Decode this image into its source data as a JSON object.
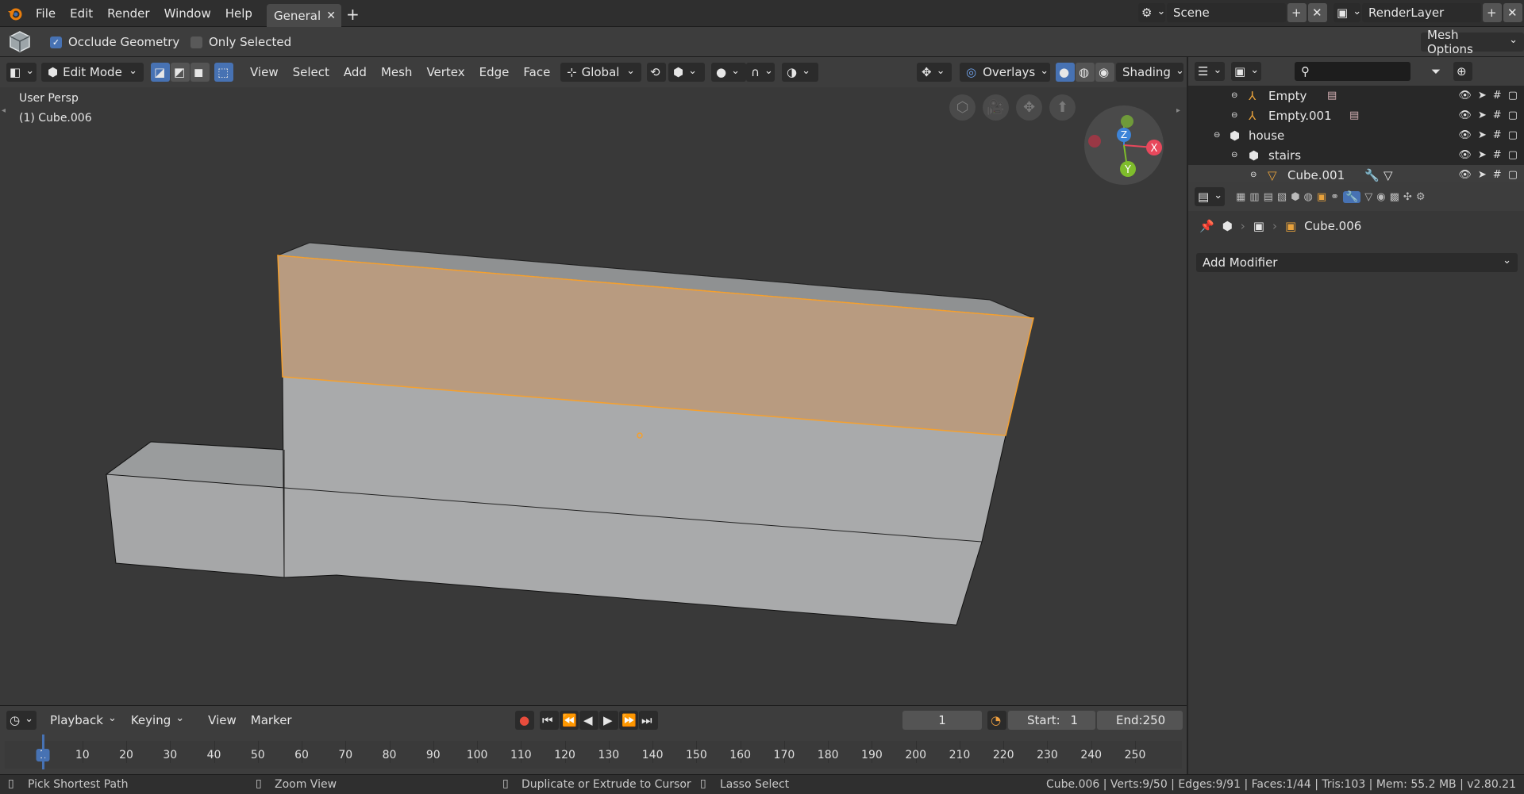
{
  "topbar": {
    "menus": [
      "File",
      "Edit",
      "Render",
      "Window",
      "Help"
    ],
    "workspace_tab": "General",
    "scene": "Scene",
    "render_layer": "RenderLayer"
  },
  "tool_header": {
    "occlude_geometry": "Occlude Geometry",
    "occlude_checked": true,
    "only_selected": "Only Selected",
    "only_selected_checked": false,
    "mesh_options": "Mesh Options"
  },
  "viewport_header": {
    "mode": "Edit Mode",
    "menus": [
      "View",
      "Select",
      "Add",
      "Mesh",
      "Vertex",
      "Edge",
      "Face"
    ],
    "orientation": "Global",
    "overlays": "Overlays",
    "shading": "Shading"
  },
  "viewport": {
    "view_name": "User Persp",
    "object_label": "(1) Cube.006",
    "gizmo": {
      "z": "Z",
      "x": "X",
      "y": "Y"
    }
  },
  "outliner": {
    "items": [
      {
        "label": "Empty",
        "icon": "empty-icon",
        "depth": 2
      },
      {
        "label": "Empty.001",
        "icon": "empty-icon",
        "depth": 2
      },
      {
        "label": "house",
        "icon": "collection-icon",
        "depth": 1
      },
      {
        "label": "stairs",
        "icon": "collection-icon",
        "depth": 2
      },
      {
        "label": "Cube.001",
        "icon": "mesh-icon",
        "depth": 3
      }
    ]
  },
  "properties": {
    "breadcrumb_object": "Cube.006",
    "add_modifier": "Add Modifier"
  },
  "timeline": {
    "menus": [
      "Playback",
      "Keying",
      "View",
      "Marker"
    ],
    "current_frame": "1",
    "start_label": "Start:",
    "start": "1",
    "end_label": "End:",
    "end": "250",
    "ticks": [
      "1",
      "10",
      "20",
      "30",
      "40",
      "50",
      "60",
      "70",
      "80",
      "90",
      "100",
      "110",
      "120",
      "130",
      "140",
      "150",
      "160",
      "170",
      "180",
      "190",
      "200",
      "210",
      "220",
      "230",
      "240",
      "250"
    ]
  },
  "statusbar": {
    "left_mouse": "Pick Shortest Path",
    "middle_mouse": "Zoom View",
    "right_mouse": "Duplicate or Extrude to Cursor",
    "alt_mouse": "Lasso Select",
    "stats": "Cube.006 | Verts:9/50 | Edges:9/91 | Faces:1/44 | Tris:103 | Mem: 55.2 MB | v2.80.21"
  },
  "colors": {
    "accent": "#4772b3",
    "selection": "#f5a02e",
    "record": "#e84c3c"
  }
}
